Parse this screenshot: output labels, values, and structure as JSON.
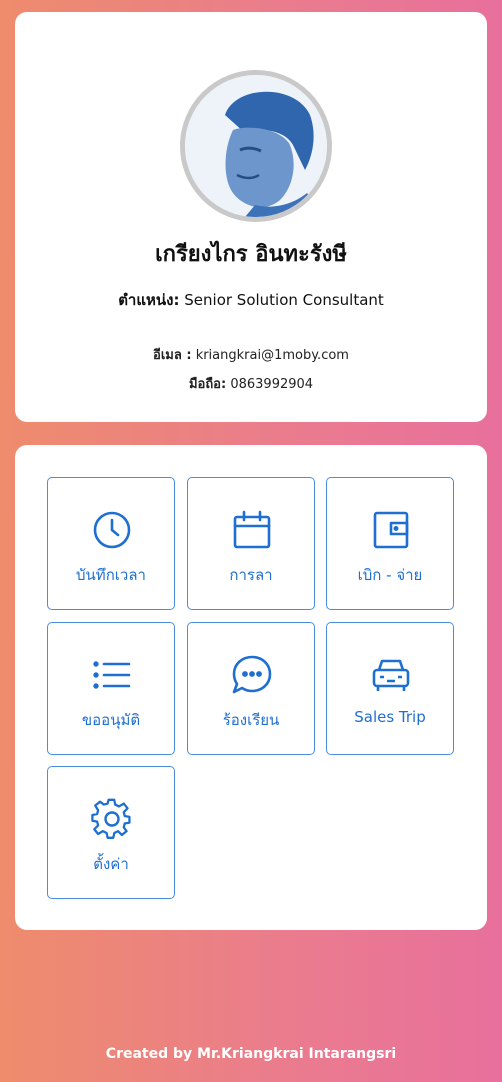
{
  "profile": {
    "name": "เกรียงไกร อินทะรังษี",
    "position_label": "ตำแหน่ง:",
    "position_value": "Senior Solution Consultant",
    "email_label": "อีเมล :",
    "email_value": "kriangkrai@1moby.com",
    "mobile_label": "มือถือ:",
    "mobile_value": "0863992904"
  },
  "menu": {
    "items": [
      {
        "label": "บันทึกเวลา",
        "icon": "clock-icon"
      },
      {
        "label": "การลา",
        "icon": "calendar-icon"
      },
      {
        "label": "เบิก - จ่าย",
        "icon": "wallet-icon"
      },
      {
        "label": "ขออนุมัติ",
        "icon": "list-icon"
      },
      {
        "label": "ร้องเรียน",
        "icon": "chat-bubble-icon"
      },
      {
        "label": "Sales Trip",
        "icon": "car-icon"
      },
      {
        "label": "ตั้งค่า",
        "icon": "gear-icon"
      }
    ]
  },
  "footer": {
    "text": "Created by Mr.Kriangkrai Intarangsri"
  },
  "colors": {
    "accent": "#1f6fd1",
    "tile_border": "#4a8ee0",
    "gradient_start": "#ee8c6c",
    "gradient_end": "#e8709c"
  }
}
